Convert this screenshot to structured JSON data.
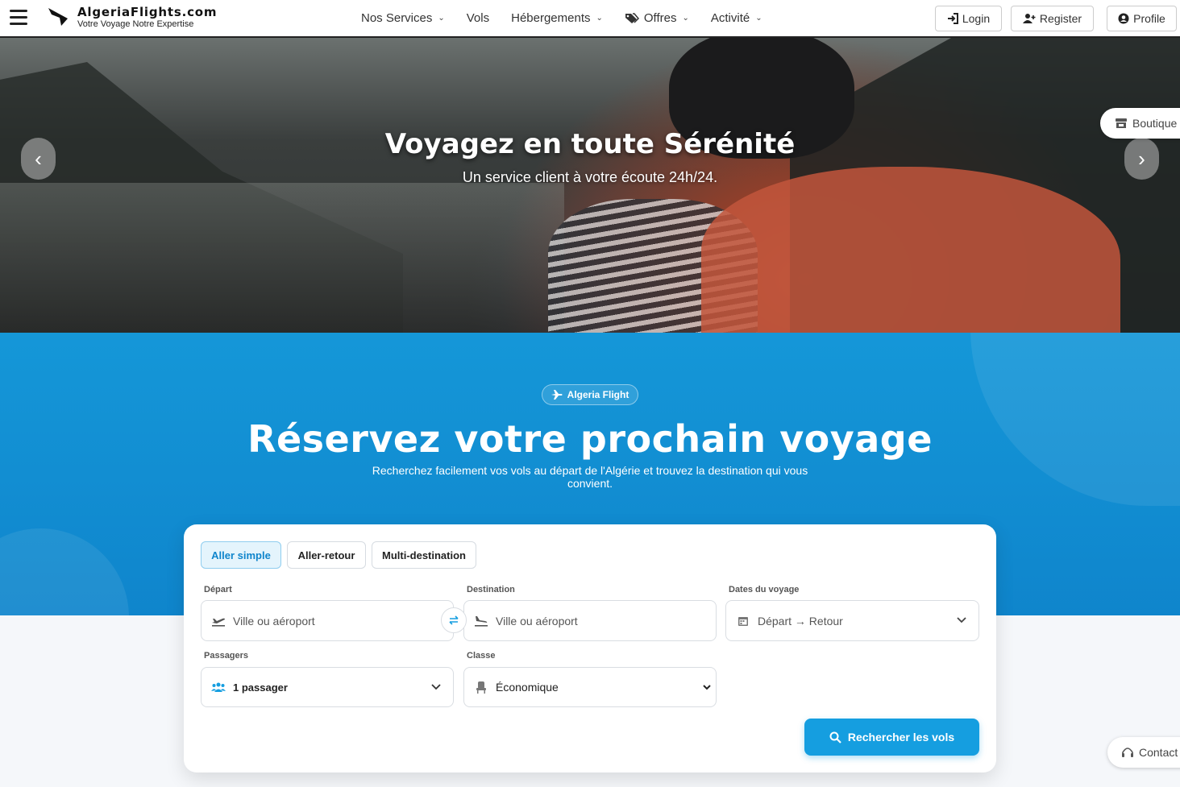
{
  "header": {
    "brand_name": "AlgeriaFlights.com",
    "brand_tagline": "Votre Voyage Notre Expertise",
    "nav": [
      {
        "label": "Nos Services",
        "has_dropdown": true
      },
      {
        "label": "Vols",
        "has_dropdown": false
      },
      {
        "label": "Hébergements",
        "has_dropdown": true
      },
      {
        "label": "Offres",
        "has_dropdown": true,
        "icon": "tags-icon"
      },
      {
        "label": "Activité",
        "has_dropdown": true
      }
    ],
    "login_label": "Login",
    "register_label": "Register",
    "profile_label": "Profile"
  },
  "hero": {
    "title": "Voyagez en toute Sérénité",
    "subtitle": "Un service client à votre écoute 24h/24.",
    "prev_glyph": "‹",
    "next_glyph": "›",
    "boutique_label": "Boutique"
  },
  "booking": {
    "badge": "Algeria Flight",
    "title": "Réservez votre prochain voyage",
    "subtitle": "Recherchez facilement vos vols au départ de l'Algérie et trouvez la destination qui vous convient.",
    "trip_types": [
      {
        "label": "Aller simple",
        "active": true
      },
      {
        "label": "Aller-retour",
        "active": false
      },
      {
        "label": "Multi-destination",
        "active": false
      }
    ],
    "depart_label": "Départ",
    "depart_placeholder": "Ville ou aéroport",
    "destination_label": "Destination",
    "destination_placeholder": "Ville ou aéroport",
    "dates_label": "Dates du voyage",
    "dates_value": "Départ → Retour",
    "passengers_label": "Passagers",
    "passengers_value": "1 passager",
    "class_label": "Classe",
    "class_value": "Économique",
    "search_label": "Rechercher les vols"
  },
  "contact_label": "Contact",
  "colors": {
    "primary": "#159ee0",
    "section_bg": "#1597d8",
    "active_tab_bg": "#e4f4fc"
  }
}
